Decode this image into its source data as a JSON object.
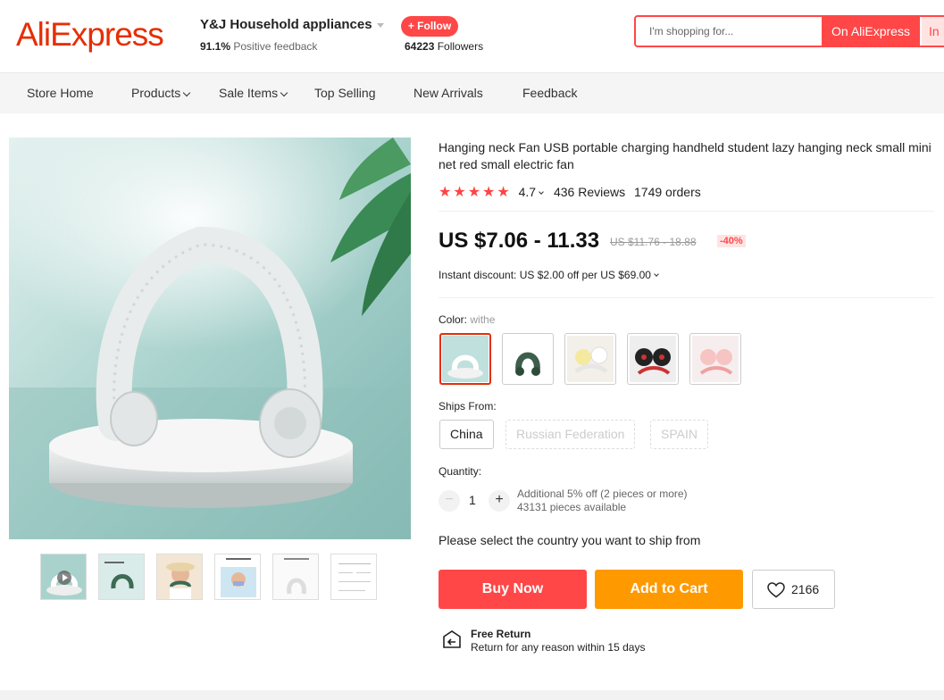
{
  "header": {
    "logo": "AliExpress",
    "store_name": "Y&J Household appliances",
    "feedback_pct": "91.1%",
    "feedback_label": "Positive feedback",
    "follow_label": "+ Follow",
    "followers_count": "64223",
    "followers_label": "Followers",
    "search_placeholder": "I'm shopping for...",
    "search_on_label": "On AliExpress",
    "search_in_label": "In"
  },
  "nav": {
    "items": [
      "Store Home",
      "Products",
      "Sale Items",
      "Top Selling",
      "New Arrivals",
      "Feedback"
    ]
  },
  "product": {
    "title": "Hanging neck Fan USB portable charging handheld student lazy hanging neck small mini net red small electric fan",
    "rating": "4.7",
    "stars": 5,
    "reviews": "436 Reviews",
    "orders": "1749 orders",
    "price": "US $7.06 - 11.33",
    "old_price": "US $11.76 - 18.88",
    "discount": "-40%",
    "instant_discount": "Instant discount: US $2.00 off per US $69.00",
    "color_label": "Color:",
    "color_value": "withe",
    "ships_from_label": "Ships From:",
    "ships_from": [
      "China",
      "Russian Federation",
      "SPAIN"
    ],
    "quantity_label": "Quantity:",
    "quantity_value": "1",
    "qty_minus": "−",
    "qty_plus": "+",
    "qty_additional": "Additional 5% off (2 pieces or more)",
    "qty_available": "43131 pieces available",
    "ship_msg": "Please select the country you want to ship from",
    "buy_now": "Buy Now",
    "add_to_cart": "Add to Cart",
    "wishlist_count": "2166",
    "return_title": "Free Return",
    "return_desc": "Return for any reason within 15 days"
  },
  "colors": {
    "accent": "#ff4747",
    "brand": "#e62e04",
    "cart": "#ff9900"
  }
}
